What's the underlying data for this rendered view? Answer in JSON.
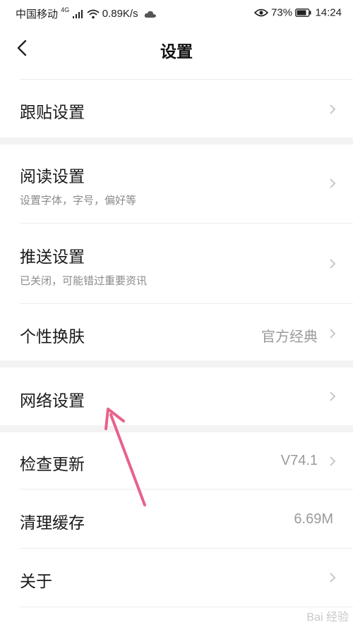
{
  "status_bar": {
    "carrier": "中国移动",
    "network": "4G",
    "speed": "0.89K/s",
    "battery": "73%",
    "time": "14:24"
  },
  "header": {
    "title": "设置"
  },
  "settings": {
    "tiegen": {
      "label": "跟贴设置"
    },
    "reading": {
      "label": "阅读设置",
      "sub": "设置字体，字号，偏好等"
    },
    "push": {
      "label": "推送设置",
      "sub": "已关闭，可能错过重要资讯"
    },
    "skin": {
      "label": "个性换肤",
      "value": "官方经典"
    },
    "network": {
      "label": "网络设置"
    },
    "update": {
      "label": "检查更新",
      "value": "V74.1"
    },
    "cache": {
      "label": "清理缓存",
      "value": "6.69M"
    },
    "about": {
      "label": "关于"
    }
  },
  "watermark": {
    "text": "Bai 经验"
  },
  "colors": {
    "arrow": "#e8628a",
    "chevron": "#c2c2c2"
  },
  "icons": [
    "signal-icon",
    "wifi-icon",
    "cloud-icon",
    "eye-icon",
    "battery-icon",
    "back-icon",
    "chevron-right-icon",
    "annotation-arrow"
  ]
}
